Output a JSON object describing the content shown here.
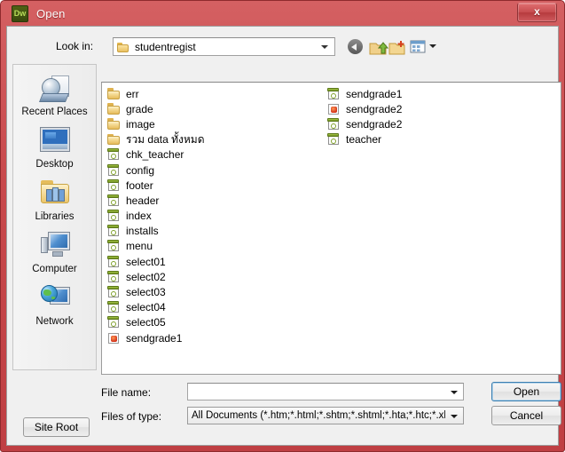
{
  "window": {
    "title": "Open",
    "app_icon": "dreamweaver-icon",
    "app_icon_text": "Dw",
    "close_label": "x",
    "titlebar_color": "#c8494c"
  },
  "lookin": {
    "label": "Look in:",
    "value": "studentregist",
    "icon": "folder-icon"
  },
  "toolbar": {
    "back": "back-icon",
    "up": "up-one-level-icon",
    "new_folder": "new-folder-icon",
    "views": "views-icon"
  },
  "places": [
    {
      "label": "Recent Places",
      "icon": "recent-places-icon"
    },
    {
      "label": "Desktop",
      "icon": "desktop-icon"
    },
    {
      "label": "Libraries",
      "icon": "libraries-icon"
    },
    {
      "label": "Computer",
      "icon": "computer-icon"
    },
    {
      "label": "Network",
      "icon": "network-icon"
    }
  ],
  "files": {
    "column1": [
      {
        "name": "err",
        "type": "folder"
      },
      {
        "name": "grade",
        "type": "folder"
      },
      {
        "name": "image",
        "type": "folder"
      },
      {
        "name": "รวม data ทั้งหมด",
        "type": "folder"
      },
      {
        "name": "chk_teacher",
        "type": "html"
      },
      {
        "name": "config",
        "type": "html"
      },
      {
        "name": "footer",
        "type": "html"
      },
      {
        "name": "header",
        "type": "html"
      },
      {
        "name": "index",
        "type": "html"
      },
      {
        "name": "installs",
        "type": "html"
      },
      {
        "name": "menu",
        "type": "html"
      },
      {
        "name": "select01",
        "type": "html"
      },
      {
        "name": "select02",
        "type": "html"
      },
      {
        "name": "select03",
        "type": "html"
      },
      {
        "name": "select04",
        "type": "html"
      },
      {
        "name": "select05",
        "type": "html"
      },
      {
        "name": "sendgrade1",
        "type": "image"
      }
    ],
    "column2": [
      {
        "name": "sendgrade1",
        "type": "html"
      },
      {
        "name": "sendgrade2",
        "type": "image"
      },
      {
        "name": "sendgrade2",
        "type": "html"
      },
      {
        "name": "teacher",
        "type": "html"
      }
    ]
  },
  "form": {
    "filename_label": "File name:",
    "filename_value": "",
    "filename_placeholder": "",
    "filetype_label": "Files of type:",
    "filetype_value": "All Documents (*.htm;*.html;*.shtm;*.shtml;*.hta;*.htc;*.xhtml;*.",
    "open_label": "Open",
    "cancel_label": "Cancel",
    "site_root_label": "Site Root"
  }
}
